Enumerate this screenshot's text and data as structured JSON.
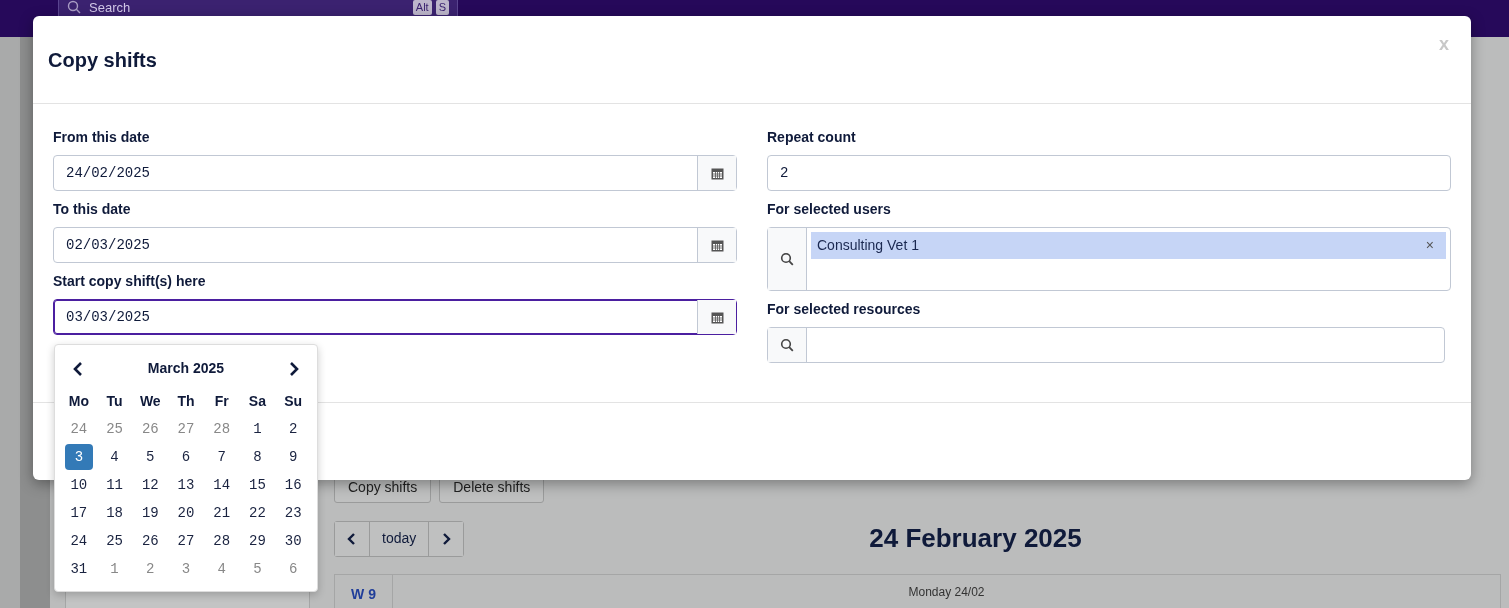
{
  "app_bar": {
    "search_placeholder": "Search",
    "shortcut_keys": [
      "Alt",
      "S"
    ]
  },
  "background": {
    "buttons": [
      "Copy shifts",
      "Delete shifts"
    ],
    "today": "today",
    "title": "24 February 2025",
    "week_label": "W 9",
    "day_header": "Monday 24/02"
  },
  "dialog": {
    "title": "Copy shifts",
    "close": "x",
    "date_fields": [
      {
        "label": "From this date",
        "value": "24/02/2025",
        "focused": false
      },
      {
        "label": "To this date",
        "value": "02/03/2025",
        "focused": false
      },
      {
        "label": "Start copy shift(s) here",
        "value": "03/03/2025",
        "focused": true
      }
    ],
    "repeat_count": {
      "label": "Repeat count",
      "value": "2"
    },
    "users": {
      "label": "For selected users",
      "tags": [
        {
          "text": "Consulting Vet 1",
          "remove": "×"
        }
      ]
    },
    "resources": {
      "label": "For selected resources"
    }
  },
  "datepicker": {
    "month": "March 2025",
    "weekdays": [
      "Mo",
      "Tu",
      "We",
      "Th",
      "Fr",
      "Sa",
      "Su"
    ],
    "weeks": [
      [
        {
          "day": "24",
          "muted": true,
          "selected": false
        },
        {
          "day": "25",
          "muted": true,
          "selected": false
        },
        {
          "day": "26",
          "muted": true,
          "selected": false
        },
        {
          "day": "27",
          "muted": true,
          "selected": false
        },
        {
          "day": "28",
          "muted": true,
          "selected": false
        },
        {
          "day": "1",
          "muted": false,
          "selected": false
        },
        {
          "day": "2",
          "muted": false,
          "selected": false
        }
      ],
      [
        {
          "day": "3",
          "muted": false,
          "selected": true
        },
        {
          "day": "4",
          "muted": false,
          "selected": false
        },
        {
          "day": "5",
          "muted": false,
          "selected": false
        },
        {
          "day": "6",
          "muted": false,
          "selected": false
        },
        {
          "day": "7",
          "muted": false,
          "selected": false
        },
        {
          "day": "8",
          "muted": false,
          "selected": false
        },
        {
          "day": "9",
          "muted": false,
          "selected": false
        }
      ],
      [
        {
          "day": "10",
          "muted": false,
          "selected": false
        },
        {
          "day": "11",
          "muted": false,
          "selected": false
        },
        {
          "day": "12",
          "muted": false,
          "selected": false
        },
        {
          "day": "13",
          "muted": false,
          "selected": false
        },
        {
          "day": "14",
          "muted": false,
          "selected": false
        },
        {
          "day": "15",
          "muted": false,
          "selected": false
        },
        {
          "day": "16",
          "muted": false,
          "selected": false
        }
      ],
      [
        {
          "day": "17",
          "muted": false,
          "selected": false
        },
        {
          "day": "18",
          "muted": false,
          "selected": false
        },
        {
          "day": "19",
          "muted": false,
          "selected": false
        },
        {
          "day": "20",
          "muted": false,
          "selected": false
        },
        {
          "day": "21",
          "muted": false,
          "selected": false
        },
        {
          "day": "22",
          "muted": false,
          "selected": false
        },
        {
          "day": "23",
          "muted": false,
          "selected": false
        }
      ],
      [
        {
          "day": "24",
          "muted": false,
          "selected": false
        },
        {
          "day": "25",
          "muted": false,
          "selected": false
        },
        {
          "day": "26",
          "muted": false,
          "selected": false
        },
        {
          "day": "27",
          "muted": false,
          "selected": false
        },
        {
          "day": "28",
          "muted": false,
          "selected": false
        },
        {
          "day": "29",
          "muted": false,
          "selected": false
        },
        {
          "day": "30",
          "muted": false,
          "selected": false
        }
      ],
      [
        {
          "day": "31",
          "muted": false,
          "selected": false
        },
        {
          "day": "1",
          "muted": true,
          "selected": false
        },
        {
          "day": "2",
          "muted": true,
          "selected": false
        },
        {
          "day": "3",
          "muted": true,
          "selected": false
        },
        {
          "day": "4",
          "muted": true,
          "selected": false
        },
        {
          "day": "5",
          "muted": true,
          "selected": false
        },
        {
          "day": "6",
          "muted": true,
          "selected": false
        }
      ]
    ]
  }
}
